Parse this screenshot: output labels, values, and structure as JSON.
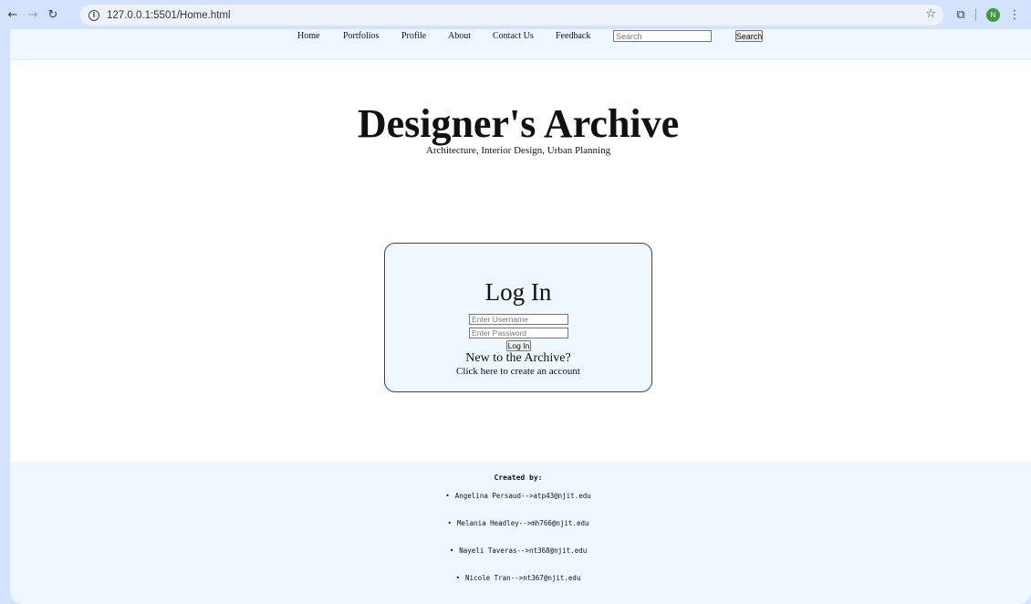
{
  "browser": {
    "url": "127.0.0.1:5501/Home.html",
    "profile_initial": "N",
    "icons": {
      "back": "arrow-left-icon",
      "forward": "arrow-right-icon",
      "reload": "reload-icon",
      "site_info": "info-icon",
      "bookmark": "star-icon",
      "extensions": "puzzle-icon",
      "menu": "kebab-menu-icon"
    }
  },
  "nav": {
    "links": [
      "Home",
      "Portfolios",
      "Profile",
      "About",
      "Contact Us",
      "Feedback"
    ],
    "search_placeholder": "Search",
    "search_button": "Search"
  },
  "hero": {
    "title": "Designer's Archive",
    "tagline": "Architecture, Interior Design, Urban Planning"
  },
  "login": {
    "title": "Log In",
    "username_placeholder": "Enter Username",
    "password_placeholder": "Enter Password",
    "button": "Log In",
    "new_prompt": "New to the Archive?",
    "create_link": "Click here to create an account"
  },
  "footer": {
    "heading": "Created by:",
    "creators": [
      "Angelina Persaud-->atp43@njit.edu",
      "Melania Headley-->mh766@njit.edu",
      "Nayeli Taveras-->nt368@njit.edu",
      "Nicole Tran-->nt367@njit.edu"
    ]
  },
  "colors": {
    "browser_frame": "#d3e3fd",
    "page_panel": "#f0f8ff",
    "avatar": "#3d9c3d"
  }
}
